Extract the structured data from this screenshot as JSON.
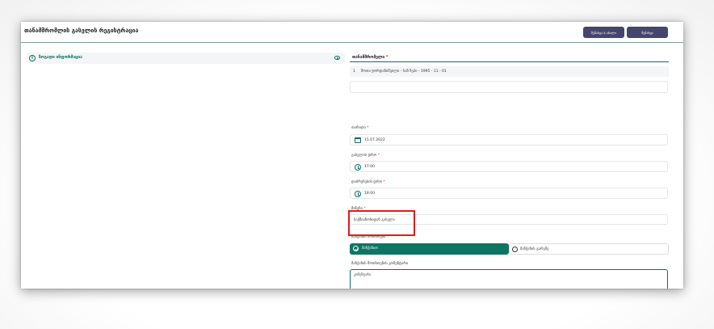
{
  "page": {
    "title": "თანამშრომლის გასვლის რეგისტრაცია"
  },
  "toolbar": {
    "save_new_label": "შენახვა & ახალი",
    "save_label": "შენახვა"
  },
  "left_panel": {
    "title": "ზოგადი ინფორმაცია",
    "icon": "info-icon",
    "action_icon": "eye-icon"
  },
  "form": {
    "employee_label": "თანამშრომელი",
    "employee": {
      "index": "1",
      "text": "შოთა ჟორდანიშვილი - სან ზეპი - 1995 - 11 - 01"
    },
    "date_label": "თარიღი",
    "date_value": "15.07.2022",
    "exit_time_label": "გასვლის დრო",
    "exit_time_value": "17:00",
    "return_time_label": "დაბრუნების დრო",
    "return_time_value": "18:00",
    "reason_label": "მიზეზი",
    "reason_value": "საქმიანობიდან გასვლა",
    "vehicle_label": "მანქანის მოთხოვნა",
    "vehicle_yes_label": "მანქანით",
    "vehicle_no_label": "მანქანის გარეშე",
    "vehicle_selected": "მანქანით",
    "comment_label": "მანქანის მოთხოვნის კომენტარი",
    "comment_value": "კომენტარი"
  },
  "colors": {
    "accent": "#0d7564",
    "button": "#46456e",
    "required": "#d93a3a",
    "highlight": "#e01b1b"
  }
}
